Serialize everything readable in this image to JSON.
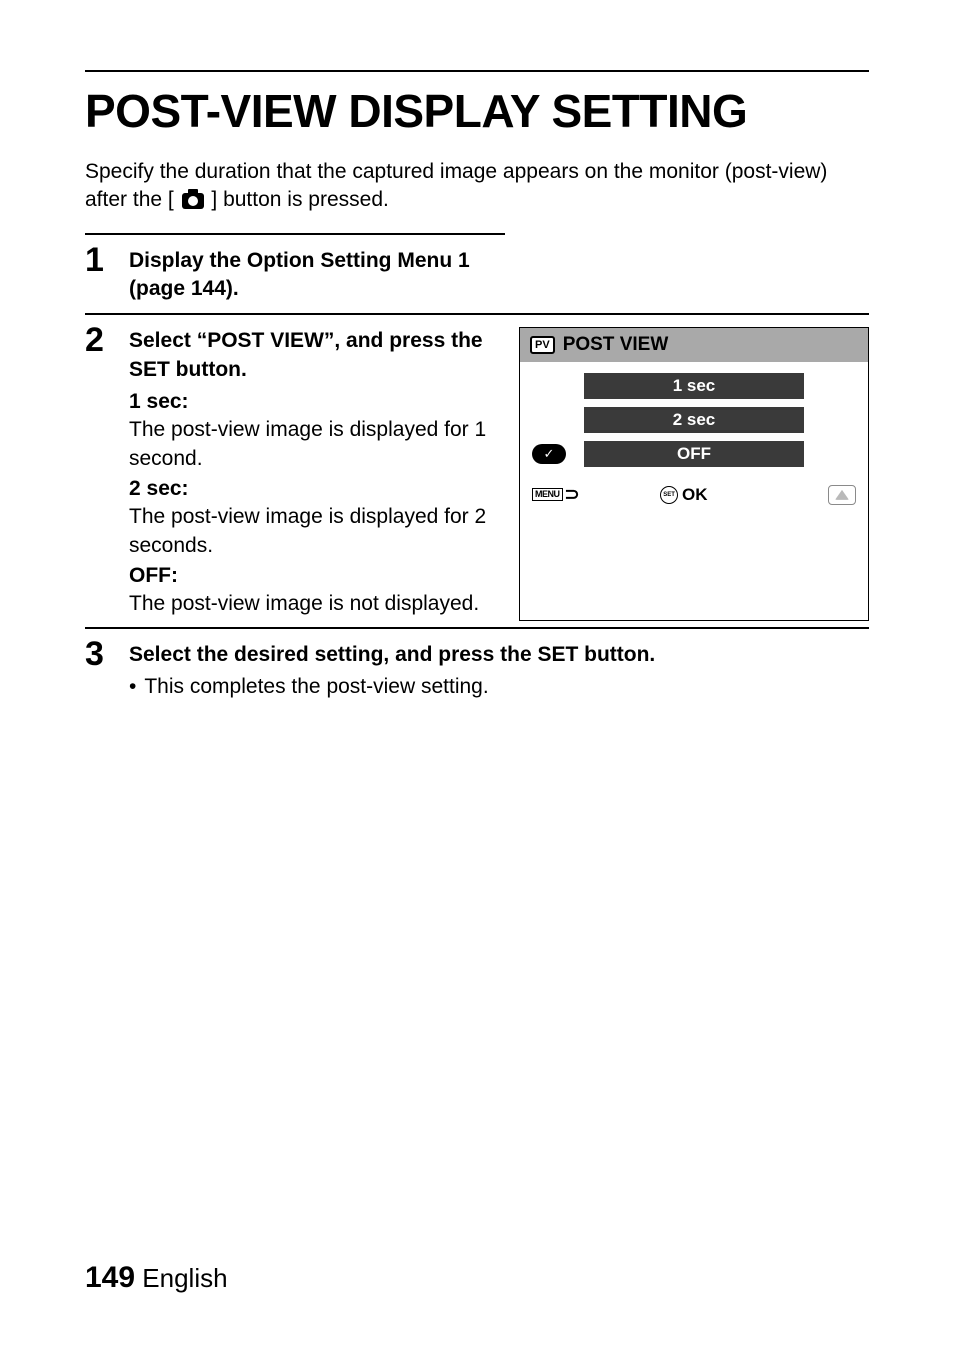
{
  "title": "POST-VIEW DISPLAY SETTING",
  "intro_before": "Specify the duration that the captured image appears on the monitor (post-view) after the [",
  "intro_after": "] button is pressed.",
  "step1": {
    "num": "1",
    "text": "Display the Option Setting Menu 1 (page 144)."
  },
  "step2": {
    "num": "2",
    "instr": "Select “POST VIEW”, and press the SET button.",
    "options": [
      {
        "label": "1 sec:",
        "desc": "The post-view image is displayed for 1 second."
      },
      {
        "label": "2 sec:",
        "desc": "The post-view image is displayed for 2 seconds."
      },
      {
        "label": "OFF:",
        "desc": "The post-view image is not displayed."
      }
    ],
    "lcd": {
      "pv_icon": "PV",
      "title": "POST VIEW",
      "rows": [
        {
          "checked": false,
          "label": "1 sec"
        },
        {
          "checked": false,
          "label": "2 sec"
        },
        {
          "checked": true,
          "label": "OFF"
        }
      ],
      "footer_menu": "MENU",
      "footer_set": "SET",
      "footer_ok": "OK"
    }
  },
  "step3": {
    "num": "3",
    "instr": "Select the desired setting, and press the SET button.",
    "bullet_marker": "•",
    "bullet": "This completes the post-view setting."
  },
  "page": {
    "num": "149",
    "lang": "English"
  }
}
